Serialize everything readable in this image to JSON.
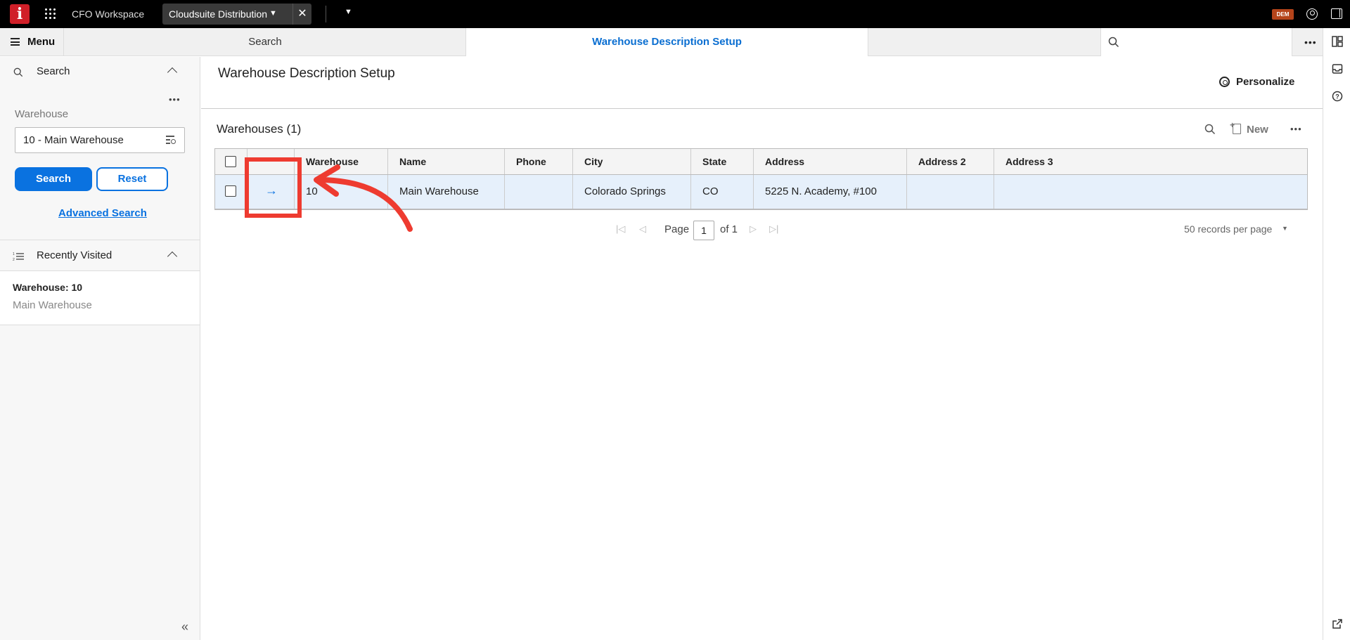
{
  "app": {
    "workspace": "CFO Workspace",
    "context_tab": "Cloudsuite Distribution",
    "user_badge": "DEM",
    "logo_letter": "i"
  },
  "nav": {
    "menu_label": "Menu",
    "tabs": [
      {
        "label": "Search",
        "active": false
      },
      {
        "label": "Warehouse Description Setup",
        "active": true
      }
    ]
  },
  "sidebar": {
    "search_title": "Search",
    "field_label": "Warehouse",
    "field_value": "10 - Main Warehouse",
    "search_button": "Search",
    "reset_button": "Reset",
    "advanced_search": "Advanced Search",
    "recent_title": "Recently Visited",
    "recent_items": [
      {
        "title": "Warehouse: 10",
        "subtitle": "Main Warehouse"
      }
    ]
  },
  "main": {
    "page_title": "Warehouse Description Setup",
    "personalize": "Personalize",
    "grid_title": "Warehouses (1)",
    "new_label": "New",
    "columns": [
      "Warehouse",
      "Name",
      "Phone",
      "City",
      "State",
      "Address",
      "Address 2",
      "Address 3"
    ],
    "rows": [
      {
        "warehouse": "10",
        "name": "Main Warehouse",
        "phone": "",
        "city": "Colorado Springs",
        "state": "CO",
        "address": "5225 N. Academy, #100",
        "address2": "",
        "address3": ""
      }
    ],
    "pager": {
      "page_label": "Page",
      "page_value": "1",
      "of_label": "of 1",
      "per_page": "50 records per page"
    }
  },
  "colors": {
    "accent": "#0a72e0",
    "logo": "#d01f28",
    "annotation": "#ee3b30",
    "selected_row": "#e6f0fb"
  },
  "icons": [
    "grid-menu-icon",
    "chevron-down-icon",
    "close-icon",
    "user-icon",
    "panel-icon",
    "hamburger-icon",
    "search-icon",
    "ellipsis-icon",
    "lookup-icon",
    "recent-list-icon",
    "collapse-left-icon",
    "gear-icon",
    "new-doc-icon",
    "arrow-right-icon",
    "first-page-icon",
    "prev-page-icon",
    "next-page-icon",
    "last-page-icon",
    "layout-icon",
    "inbox-icon",
    "help-icon",
    "external-link-icon"
  ]
}
